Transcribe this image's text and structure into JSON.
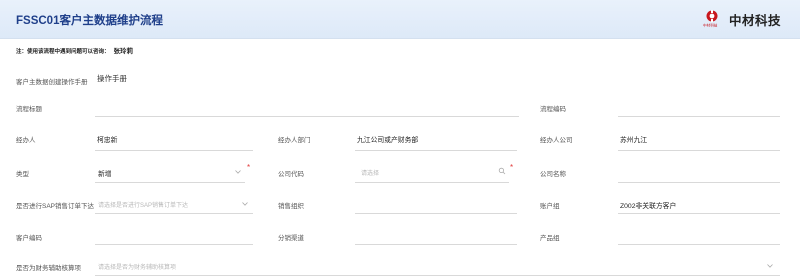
{
  "header": {
    "title": "FSSC01客户主数据维护流程",
    "logo_sub": "中材科技",
    "logo_text": "中材科技"
  },
  "note": {
    "text": "注：使用该流程中遇到问题可以咨询：",
    "contact": "张玲莉"
  },
  "form": {
    "manual_label": "客户主数据创建操作手册",
    "manual_link": "操作手册",
    "flow_title_label": "流程标题",
    "flow_no_label": "流程编码",
    "handler_label": "经办人",
    "handler_value": "柯忠新",
    "handler_dept_label": "经办人部门",
    "handler_dept_value": "九江公司或产财务部",
    "handler_company_label": "经办人公司",
    "handler_company_value": "苏州九江",
    "type_label": "类型",
    "type_value": "新增",
    "company_code_label": "公司代码",
    "company_code_placeholder": "请选择",
    "company_name_label": "公司名称",
    "sap_label": "是否进行SAP销售订单下达",
    "sap_placeholder": "请选择是否进行SAP销售订单下达",
    "sales_org_label": "销售组织",
    "account_group_label": "账户组",
    "account_group_value": "Z002非关联方客户",
    "customer_code_label": "客户编码",
    "distribution_label": "分销渠道",
    "product_group_label": "产品组",
    "aux_label": "是否为财务辅助核算项",
    "aux_placeholder": "请选择是否为财务辅助核算项"
  },
  "colors": {
    "accent": "#1f3f8a",
    "required": "#e23b3b",
    "logo_red": "#c8161d"
  },
  "icons": {
    "logo": "cnbm-logo-icon",
    "dropdown": "chevron-down-icon",
    "search": "search-icon"
  }
}
